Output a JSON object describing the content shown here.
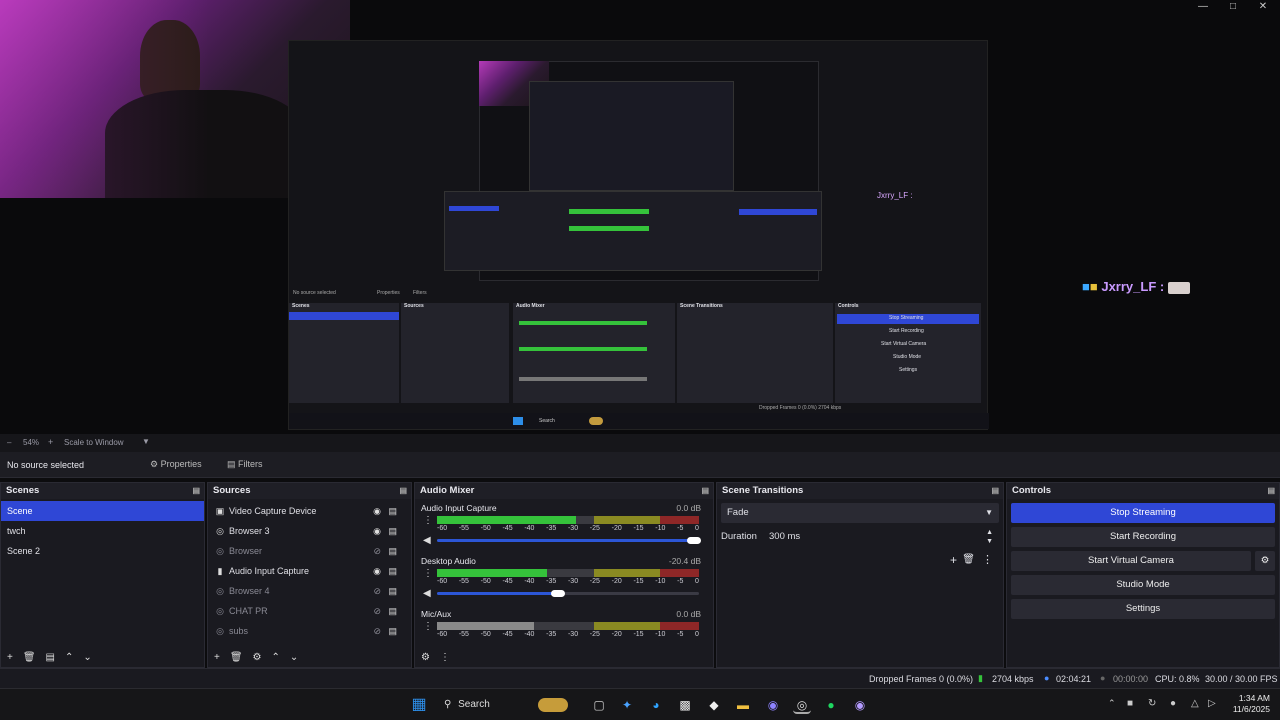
{
  "preview": {
    "chat_user_small": "Jxrry_LF :",
    "chat_user_large": "Jxrry_LF :",
    "nested_no_source": "No source selected",
    "nested_tabs": [
      "Properties",
      "Filters"
    ],
    "nested_docks": [
      "Scenes",
      "Sources",
      "Audio Mixer",
      "Scene Transitions",
      "Controls"
    ],
    "nested_controls": [
      "Stop Streaming",
      "Start Recording",
      "Start Virtual Camera",
      "Studio Mode",
      "Settings"
    ],
    "nested_search": "Search",
    "nested_stats": "Dropped Frames 0 (0.0%)  2704 kbps"
  },
  "toolbar": {
    "zoom": "54%",
    "scale_mode": "Scale to Window",
    "no_source": "No source selected",
    "properties_label": "Properties",
    "filters_label": "Filters"
  },
  "scenes": {
    "title": "Scenes",
    "items": [
      "Scene",
      "twch",
      "Scene 2"
    ]
  },
  "sources": {
    "title": "Sources",
    "items": [
      {
        "label": "Video Capture Device",
        "icon": "camera-icon",
        "visible": true
      },
      {
        "label": "Browser 3",
        "icon": "globe-icon",
        "visible": true
      },
      {
        "label": "Browser",
        "icon": "globe-icon",
        "visible": false
      },
      {
        "label": "Audio Input Capture",
        "icon": "microphone-icon",
        "visible": true
      },
      {
        "label": "Browser 4",
        "icon": "globe-icon",
        "visible": false
      },
      {
        "label": "CHAT PR",
        "icon": "globe-icon",
        "visible": false
      },
      {
        "label": "subs",
        "icon": "globe-icon",
        "visible": false
      }
    ]
  },
  "mixer": {
    "title": "Audio Mixer",
    "channels": [
      {
        "name": "Audio Input Capture",
        "db": "0.0 dB",
        "level": 0.53,
        "fader": 1.0,
        "color": "#35c23b"
      },
      {
        "name": "Desktop Audio",
        "db": "-20.4 dB",
        "level": 0.42,
        "fader": 0.48,
        "color": "#35c23b"
      },
      {
        "name": "Mic/Aux",
        "db": "0.0 dB",
        "level": 0.37,
        "fader": 1.0,
        "color": "#8a8a8a"
      }
    ],
    "ticks": [
      "-60",
      "-55",
      "-50",
      "-45",
      "-40",
      "-35",
      "-30",
      "-25",
      "-20",
      "-15",
      "-10",
      "-5",
      "0"
    ]
  },
  "transitions": {
    "title": "Scene Transitions",
    "selected": "Fade",
    "duration_label": "Duration",
    "duration_value": "300 ms"
  },
  "controls": {
    "title": "Controls",
    "stop_streaming": "Stop Streaming",
    "start_recording": "Start Recording",
    "start_virtual_camera": "Start Virtual Camera",
    "studio_mode": "Studio Mode",
    "settings": "Settings",
    "accent": "#2f47d6"
  },
  "status": {
    "dropped": "Dropped Frames 0 (0.0%)",
    "bitrate": "2704 kbps",
    "stream_time": "02:04:21",
    "rec_time": "00:00:00",
    "cpu": "CPU: 0.8%",
    "fps": "30.00 / 30.00 FPS"
  },
  "taskbar": {
    "search": "Search",
    "time": "1:34 AM",
    "date": "11/6/2025"
  }
}
